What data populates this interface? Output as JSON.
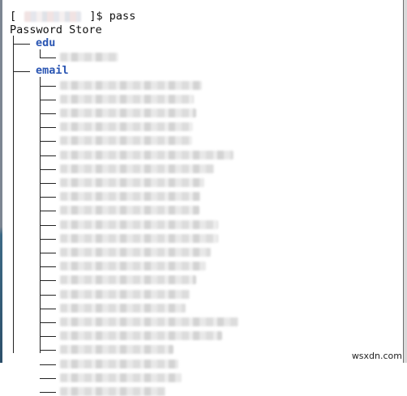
{
  "prompt": {
    "open_bracket": "[",
    "close_and_command": "]$ pass"
  },
  "store": {
    "title": "Password Store",
    "folders": [
      {
        "name": "edu",
        "entry_count": 1
      },
      {
        "name": "email",
        "entry_count": 23
      }
    ]
  },
  "watermark": "wsxdn.com",
  "colors": {
    "folder_label": "#2b56b3",
    "text": "#111111",
    "background": "#ffffff"
  }
}
